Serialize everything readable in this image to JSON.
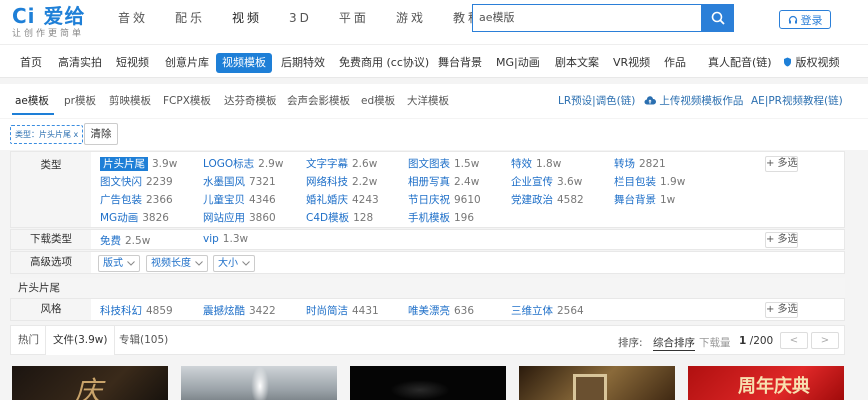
{
  "logo": {
    "main": "Ci 爱给",
    "sub": "让创作更简单"
  },
  "topnav": [
    "音效",
    "配乐",
    "视频",
    "3D",
    "平面",
    "游戏",
    "教程"
  ],
  "search": {
    "value": "ae模版"
  },
  "login": {
    "label": "登录"
  },
  "catnav": [
    "首页",
    "高清实拍",
    "短视频",
    "创意片库",
    "视频模板",
    "后期特效",
    "免费商用 (cc协议)",
    "舞台背景",
    "MG|动画",
    "剧本文案",
    "VR视频",
    "作品",
    "真人配音(链)",
    "版权视频"
  ],
  "subtabs": [
    "ae模板",
    "pr模板",
    "剪映模板",
    "FCPX模板",
    "达芬奇模板",
    "会声会影模板",
    "ed模板",
    "大洋模板"
  ],
  "subtabs_right": {
    "lr": "LR预设|调色(链)",
    "upload": "上传视频模板作品",
    "aepr": "AE|PR视频教程(链)"
  },
  "chip": {
    "label": "类型：片头片尾 x",
    "clear": "清除"
  },
  "filters": {
    "type_label": "类型",
    "type_items": [
      {
        "name": "片头片尾",
        "count": "3.9w"
      },
      {
        "name": "LOGO标志",
        "count": "2.9w"
      },
      {
        "name": "文字字幕",
        "count": "2.6w"
      },
      {
        "name": "图文图表",
        "count": "1.5w"
      },
      {
        "name": "特效",
        "count": "1.8w"
      },
      {
        "name": "转场",
        "count": "2821"
      },
      {
        "name": "图文快闪",
        "count": "2239"
      },
      {
        "name": "水墨国风",
        "count": "7321"
      },
      {
        "name": "网络科技",
        "count": "2.2w"
      },
      {
        "name": "相册写真",
        "count": "2.4w"
      },
      {
        "name": "企业宣传",
        "count": "3.6w"
      },
      {
        "name": "栏目包装",
        "count": "1.9w"
      },
      {
        "name": "广告包装",
        "count": "2366"
      },
      {
        "name": "儿童宝贝",
        "count": "4346"
      },
      {
        "name": "婚礼婚庆",
        "count": "4243"
      },
      {
        "name": "节日庆祝",
        "count": "9610"
      },
      {
        "name": "党建政治",
        "count": "4582"
      },
      {
        "name": "舞台背景",
        "count": "1w"
      },
      {
        "name": "MG动画",
        "count": "3826"
      },
      {
        "name": "网站应用",
        "count": "3860"
      },
      {
        "name": "C4D模板",
        "count": "128"
      },
      {
        "name": "手机模板",
        "count": "196"
      }
    ],
    "more": "+ 多选",
    "download_label": "下载类型",
    "download_items": [
      {
        "name": "免费",
        "count": "2.5w"
      },
      {
        "name": "vip",
        "count": "1.3w"
      }
    ],
    "advanced_label": "高级选项",
    "advanced_dropdowns": [
      "版式",
      "视频长度",
      "大小"
    ],
    "section_title": "片头片尾",
    "style_label": "风格",
    "style_items": [
      {
        "name": "科技科幻",
        "count": "4859"
      },
      {
        "name": "震撼炫酷",
        "count": "3422"
      },
      {
        "name": "时尚简洁",
        "count": "4431"
      },
      {
        "name": "唯美漂亮",
        "count": "636"
      },
      {
        "name": "三维立体",
        "count": "2564"
      }
    ]
  },
  "sortbar": {
    "tabs": [
      "热门",
      "文件(3.9w)",
      "专辑(105)"
    ],
    "sort_label": "排序:",
    "sort_options": [
      "综合排序",
      "下载量"
    ],
    "page_current": "1",
    "page_total": "/200",
    "prev": "<",
    "next": ">"
  },
  "thumb_texts": [
    "庆",
    "周年庆典"
  ],
  "colors": {
    "accent": "#1e7fd7",
    "link": "#1e6fc8"
  }
}
